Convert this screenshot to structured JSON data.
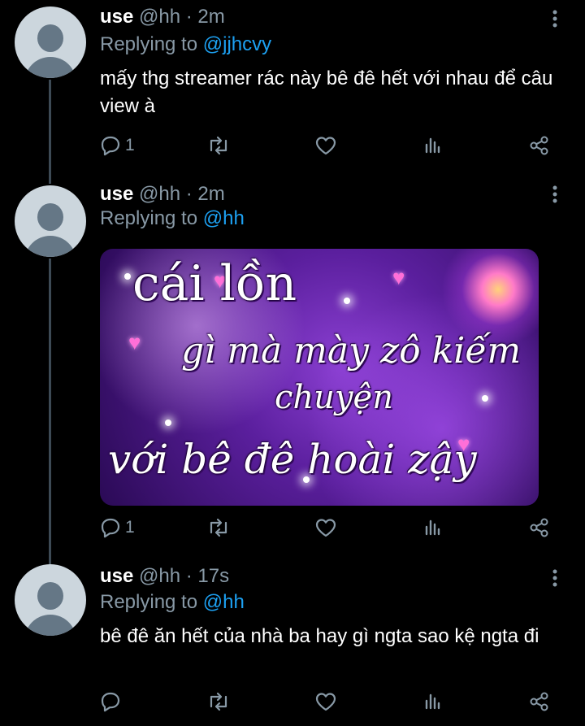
{
  "tweets": [
    {
      "name": "use",
      "meta": "@hh · 2m",
      "replying_prefix": "Replying to ",
      "replying_handle": "@jjhcvy",
      "text": "mấy thg streamer rác này bê đê hết với nhau để câu view à",
      "reply_count": "1"
    },
    {
      "name": "use",
      "meta": "@hh · 2m",
      "replying_prefix": "Replying to ",
      "replying_handle": "@hh",
      "image_lines": [
        "cái lồn",
        "gì mà mày zô kiếm",
        "chuyện",
        "với bê đê hoài zậy"
      ],
      "reply_count": "1"
    },
    {
      "name": "use",
      "meta": "@hh · 17s",
      "replying_prefix": "Replying to ",
      "replying_handle": "@hh",
      "text": "bê đê ăn hết của nhà ba hay gì ngta sao kệ ngta đi",
      "reply_count": ""
    }
  ],
  "icons": [
    "reply-icon",
    "retweet-icon",
    "like-icon",
    "analytics-icon",
    "share-icon",
    "more-options-icon"
  ],
  "colors": {
    "background": "#000000",
    "secondary_text": "#8899a6",
    "link": "#1da1f2",
    "avatar_bg": "#ccd6dd",
    "avatar_fg": "#657786",
    "thread_line": "#3d4a55"
  }
}
